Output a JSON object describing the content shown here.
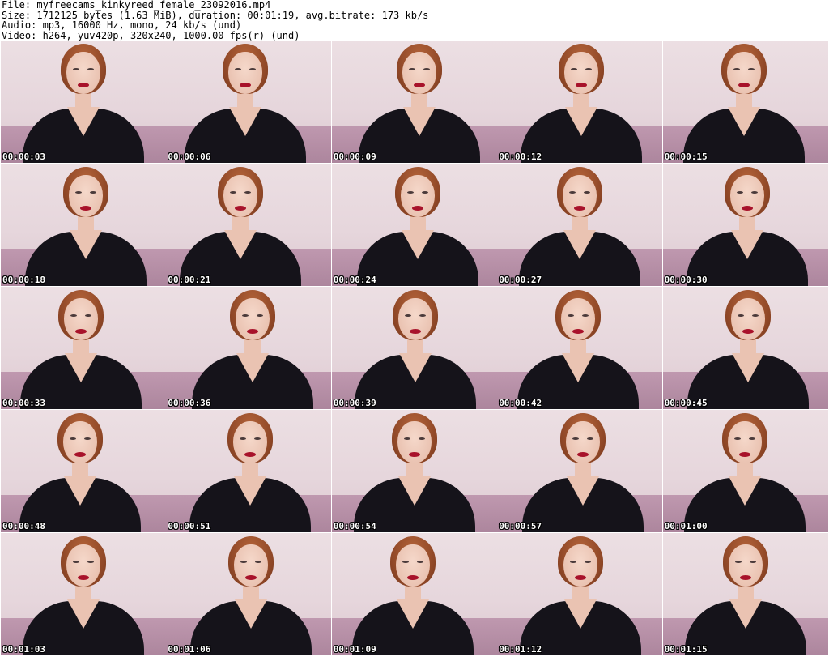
{
  "header": {
    "file": "File: myfreecams_kinkyreed_female_23092016.mp4",
    "size": "Size: 1712125 bytes (1.63 MiB), duration: 00:01:19, avg.bitrate: 173 kb/s",
    "audio": "Audio: mp3, 16000 Hz, mono, 24 kb/s (und)",
    "video": "Video: h264, yuv420p, 320x240, 1000.00 fps(r) (und)"
  },
  "thumbnails": [
    {
      "timestamp": "00:00:03"
    },
    {
      "timestamp": "00:00:06"
    },
    {
      "timestamp": "00:00:09"
    },
    {
      "timestamp": "00:00:12"
    },
    {
      "timestamp": "00:00:15"
    },
    {
      "timestamp": "00:00:18"
    },
    {
      "timestamp": "00:00:21"
    },
    {
      "timestamp": "00:00:24"
    },
    {
      "timestamp": "00:00:27"
    },
    {
      "timestamp": "00:00:30"
    },
    {
      "timestamp": "00:00:33"
    },
    {
      "timestamp": "00:00:36"
    },
    {
      "timestamp": "00:00:39"
    },
    {
      "timestamp": "00:00:42"
    },
    {
      "timestamp": "00:00:45"
    },
    {
      "timestamp": "00:00:48"
    },
    {
      "timestamp": "00:00:51"
    },
    {
      "timestamp": "00:00:54"
    },
    {
      "timestamp": "00:00:57"
    },
    {
      "timestamp": "00:01:00"
    },
    {
      "timestamp": "00:01:03"
    },
    {
      "timestamp": "00:01:06"
    },
    {
      "timestamp": "00:01:09"
    },
    {
      "timestamp": "00:01:12"
    },
    {
      "timestamp": "00:01:15"
    }
  ]
}
